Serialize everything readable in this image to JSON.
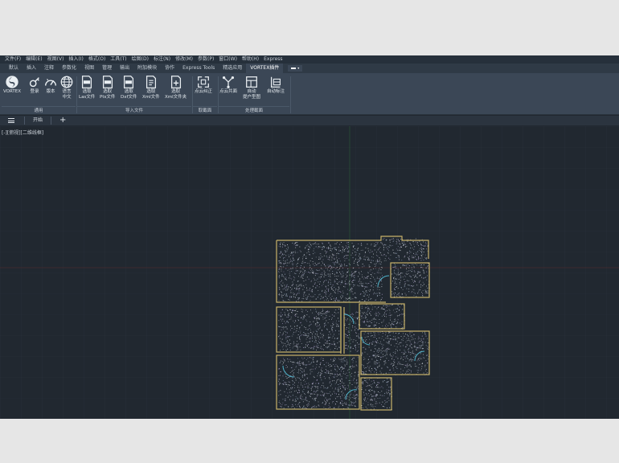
{
  "menu": [
    "文件(F)",
    "编辑(E)",
    "视图(V)",
    "插入(I)",
    "格式(O)",
    "工具(T)",
    "绘图(D)",
    "标注(N)",
    "修改(M)",
    "参数(P)",
    "窗口(W)",
    "帮助(H)",
    "Express"
  ],
  "tabs": [
    "默认",
    "插入",
    "注释",
    "参数化",
    "视图",
    "管理",
    "输出",
    "附加模块",
    "协作",
    "Express Tools",
    "精选应用",
    "VORTEX插件"
  ],
  "active_tab": "VORTEX插件",
  "ribbon": {
    "groups": {
      "general": "通用",
      "import": "导入文件",
      "section": "取截面",
      "process": "处理截面"
    },
    "buttons": {
      "vortex": "VORTEX",
      "login": "登录",
      "version": "版本",
      "language": "语言\n中文",
      "las": "选取\nLas文件",
      "pts": "选取\nPts文件",
      "dxf": "选取\nDxf文件",
      "xml": "选取\nXml文件",
      "xml_folder": "选取\nXml文件夹",
      "pointcloud_correct": "点云纠正",
      "pointcloud_project": "点云共面",
      "auto_plan": "自动\n提户型图",
      "auto_annotate": "自动标注"
    }
  },
  "file_tab": "开始",
  "viewport_label": "[-][俯视][二维线框]",
  "colors": {
    "app_bg": "#212830",
    "ribbon_bg": "#3b4756",
    "wall": "#c8b26a",
    "door": "#4fb1c9",
    "points": "#d8dde6"
  }
}
